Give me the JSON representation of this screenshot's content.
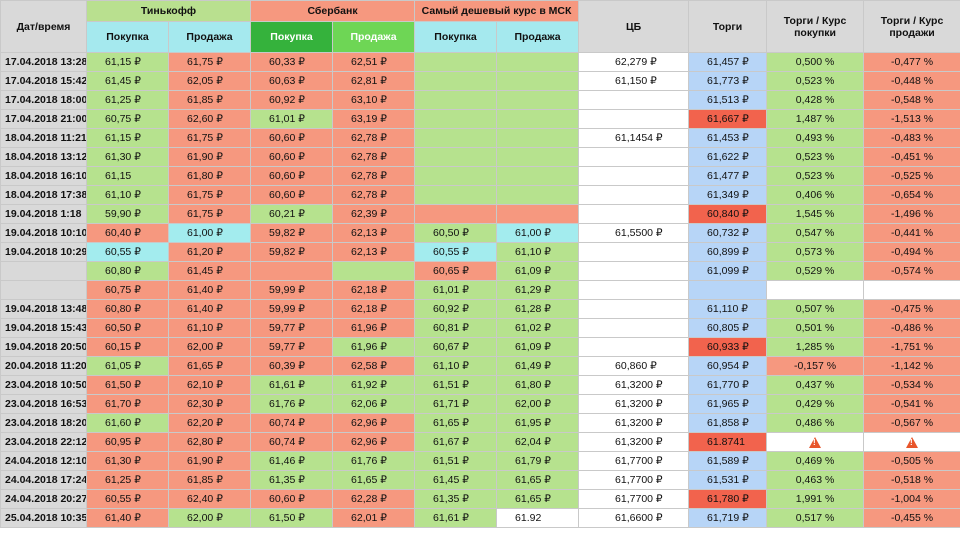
{
  "header": {
    "date_label": "Дат/время",
    "tinkoff": "Тинькофф",
    "sber": "Сбербанк",
    "cheapest": "Самый дешевый курс в МСК",
    "buy": "Покупка",
    "sell": "Продажа",
    "cb": "ЦБ",
    "torgi": "Торги",
    "torgi_buy": "Торги / Курс покупки",
    "torgi_sell": "Торги / Курс продажи"
  },
  "colors": {
    "grey": "#d9d9d9",
    "header_green": "#b9e08f",
    "header_red": "#f6987f",
    "header_blue": "#a5e9ee",
    "header_dark_green": "#35b23c",
    "header_mid_green": "#6ed655",
    "green": "#b6e28e",
    "red": "#f6987f",
    "cyan": "#a3ecee",
    "blue": "#b7d5f7",
    "dark_red": "#f2634d",
    "white": "#ffffff"
  },
  "rows": [
    {
      "date": "17.04.2018 13:28",
      "tb": "61,15 ₽",
      "ts": "61,75 ₽",
      "sb": "60,33 ₽",
      "ss": "62,51 ₽",
      "cb_": "",
      "cs": "",
      "cbr": "62,279 ₽",
      "torgi": "61,457 ₽",
      "pb": "0,500 %",
      "ps": "-0,477 %",
      "colors": [
        "grey",
        "green",
        "red",
        "red",
        "red",
        "green",
        "green",
        "white",
        "blue",
        "green",
        "red"
      ]
    },
    {
      "date": "17.04.2018 15:42",
      "tb": "61,45 ₽",
      "ts": "62,05 ₽",
      "sb": "60,63 ₽",
      "ss": "62,81 ₽",
      "cb_": "",
      "cs": "",
      "cbr": "61,150 ₽",
      "torgi": "61,773 ₽",
      "pb": "0,523 %",
      "ps": "-0,448 %",
      "colors": [
        "grey",
        "green",
        "red",
        "red",
        "red",
        "green",
        "green",
        "white",
        "blue",
        "green",
        "red"
      ]
    },
    {
      "date": "17.04.2018 18:00",
      "tb": "61,25 ₽",
      "ts": "61,85 ₽",
      "sb": "60,92 ₽",
      "ss": "63,10 ₽",
      "cb_": "",
      "cs": "",
      "cbr": "",
      "torgi": "61,513 ₽",
      "pb": "0,428 %",
      "ps": "-0,548 %",
      "colors": [
        "grey",
        "green",
        "red",
        "red",
        "red",
        "green",
        "green",
        "white",
        "blue",
        "green",
        "red"
      ]
    },
    {
      "date": "17.04.2018 21:00",
      "tb": "60,75 ₽",
      "ts": "62,60 ₽",
      "sb": "61,01 ₽",
      "ss": "63,19 ₽",
      "cb_": "",
      "cs": "",
      "cbr": "",
      "torgi": "61,667 ₽",
      "pb": "1,487 %",
      "ps": "-1,513 %",
      "colors": [
        "grey",
        "green",
        "red",
        "green",
        "red",
        "green",
        "green",
        "white",
        "dark_red",
        "green",
        "red"
      ]
    },
    {
      "date": "18.04.2018 11:21",
      "tb": "61,15 ₽",
      "ts": "61,75 ₽",
      "sb": "60,60 ₽",
      "ss": "62,78 ₽",
      "cb_": "",
      "cs": "",
      "cbr": "61,1454 ₽",
      "torgi": "61,453 ₽",
      "pb": "0,493 %",
      "ps": "-0,483 %",
      "colors": [
        "grey",
        "green",
        "red",
        "red",
        "red",
        "green",
        "green",
        "white",
        "blue",
        "green",
        "red"
      ]
    },
    {
      "date": "18.04.2018 13:12",
      "tb": "61,30 ₽",
      "ts": "61,90 ₽",
      "sb": "60,60 ₽",
      "ss": "62,78 ₽",
      "cb_": "",
      "cs": "",
      "cbr": "",
      "torgi": "61,622 ₽",
      "pb": "0,523 %",
      "ps": "-0,451 %",
      "colors": [
        "grey",
        "green",
        "red",
        "red",
        "red",
        "green",
        "green",
        "white",
        "blue",
        "green",
        "red"
      ]
    },
    {
      "date": "18.04.2018 16:10",
      "tb": "61,15",
      "ts": "61,80 ₽",
      "sb": "60,60 ₽",
      "ss": "62,78 ₽",
      "cb_": "",
      "cs": "",
      "cbr": "",
      "torgi": "61,477 ₽",
      "pb": "0,523 %",
      "ps": "-0,525 %",
      "colors": [
        "grey",
        "green",
        "red",
        "red",
        "red",
        "green",
        "green",
        "white",
        "blue",
        "green",
        "red"
      ]
    },
    {
      "date": "18.04.2018 17:38",
      "tb": "61,10 ₽",
      "ts": "61,75 ₽",
      "sb": "60,60 ₽",
      "ss": "62,78 ₽",
      "cb_": "",
      "cs": "",
      "cbr": "",
      "torgi": "61,349 ₽",
      "pb": "0,406 %",
      "ps": "-0,654 %",
      "colors": [
        "grey",
        "green",
        "red",
        "red",
        "red",
        "green",
        "green",
        "white",
        "blue",
        "green",
        "red"
      ]
    },
    {
      "date": "19.04.2018 1:18",
      "tb": "59,90 ₽",
      "ts": "61,75 ₽",
      "sb": "60,21 ₽",
      "ss": "62,39 ₽",
      "cb_": "",
      "cs": "",
      "cbr": "",
      "torgi": "60,840 ₽",
      "pb": "1,545 %",
      "ps": "-1,496 %",
      "colors": [
        "grey",
        "green",
        "red",
        "green",
        "red",
        "red",
        "red",
        "white",
        "dark_red",
        "green",
        "red"
      ]
    },
    {
      "date": "19.04.2018 10:10",
      "tb": "60,40 ₽",
      "ts": "61,00 ₽",
      "sb": "59,82 ₽",
      "ss": "62,13 ₽",
      "cb_": "60,50 ₽",
      "cs": "61,00 ₽",
      "cbr": "61,5500 ₽",
      "torgi": "60,732 ₽",
      "pb": "0,547 %",
      "ps": "-0,441 %",
      "colors": [
        "grey",
        "red",
        "cyan",
        "red",
        "red",
        "green",
        "cyan",
        "white",
        "blue",
        "green",
        "red"
      ]
    },
    {
      "date": "19.04.2018 10:29",
      "tb": "60,55 ₽",
      "ts": "61,20 ₽",
      "sb": "59,82 ₽",
      "ss": "62,13 ₽",
      "cb_": "60,55 ₽",
      "cs": "61,10 ₽",
      "cbr": "",
      "torgi": "60,899 ₽",
      "pb": "0,573 %",
      "ps": "-0,494 %",
      "colors": [
        "grey",
        "cyan",
        "red",
        "red",
        "red",
        "cyan",
        "green",
        "white",
        "blue",
        "green",
        "red"
      ]
    },
    {
      "date": "",
      "tb": "60,80 ₽",
      "ts": "61,45 ₽",
      "sb": "",
      "ss": "",
      "cb_": "60,65 ₽",
      "cs": "61,09 ₽",
      "cbr": "",
      "torgi": "61,099 ₽",
      "pb": "0,529 %",
      "ps": "-0,574 %",
      "colors": [
        "grey",
        "green",
        "red",
        "red",
        "green",
        "red",
        "green",
        "white",
        "blue",
        "green",
        "red"
      ]
    },
    {
      "date": "",
      "tb": "60,75 ₽",
      "ts": "61,40 ₽",
      "sb": "59,99 ₽",
      "ss": "62,18 ₽",
      "cb_": "61,01 ₽",
      "cs": "61,29 ₽",
      "cbr": "",
      "torgi": "",
      "pb": "",
      "ps": "",
      "colors": [
        "grey",
        "red",
        "red",
        "red",
        "red",
        "green",
        "green",
        "white",
        "blue",
        "white",
        "white"
      ]
    },
    {
      "date": "19.04.2018 13:48",
      "tb": "60,80 ₽",
      "ts": "61,40 ₽",
      "sb": "59,99 ₽",
      "ss": "62,18 ₽",
      "cb_": "60,92 ₽",
      "cs": "61,28 ₽",
      "cbr": "",
      "torgi": "61,110 ₽",
      "pb": "0,507 %",
      "ps": "-0,475 %",
      "colors": [
        "grey",
        "red",
        "red",
        "red",
        "red",
        "green",
        "green",
        "white",
        "blue",
        "green",
        "red"
      ]
    },
    {
      "date": "19.04.2018 15:43",
      "tb": "60,50 ₽",
      "ts": "61,10 ₽",
      "sb": "59,77 ₽",
      "ss": "61,96 ₽",
      "cb_": "60,81 ₽",
      "cs": "61,02 ₽",
      "cbr": "",
      "torgi": "60,805 ₽",
      "pb": "0,501 %",
      "ps": "-0,486 %",
      "colors": [
        "grey",
        "red",
        "red",
        "red",
        "red",
        "green",
        "green",
        "white",
        "blue",
        "green",
        "red"
      ]
    },
    {
      "date": "19.04.2018 20:50",
      "tb": "60,15 ₽",
      "ts": "62,00 ₽",
      "sb": "59,77 ₽",
      "ss": "61,96 ₽",
      "cb_": "60,67 ₽",
      "cs": "61,09 ₽",
      "cbr": "",
      "torgi": "60,933 ₽",
      "pb": "1,285 %",
      "ps": "-1,751 %",
      "colors": [
        "grey",
        "red",
        "red",
        "red",
        "green",
        "green",
        "green",
        "white",
        "dark_red",
        "green",
        "red"
      ]
    },
    {
      "date": "20.04.2018 11:20",
      "tb": "61,05 ₽",
      "ts": "61,65 ₽",
      "sb": "60,39 ₽",
      "ss": "62,58 ₽",
      "cb_": "61,10 ₽",
      "cs": "61,49 ₽",
      "cbr": "60,860 ₽",
      "torgi": "60,954 ₽",
      "pb": "-0,157 %",
      "ps": "-1,142 %",
      "colors": [
        "grey",
        "green",
        "red",
        "red",
        "red",
        "green",
        "green",
        "white",
        "blue",
        "red",
        "red"
      ]
    },
    {
      "date": "23.04.2018 10:50",
      "tb": "61,50 ₽",
      "ts": "62,10 ₽",
      "sb": "61,61 ₽",
      "ss": "61,92 ₽",
      "cb_": "61,51 ₽",
      "cs": "61,80 ₽",
      "cbr": "61,3200 ₽",
      "torgi": "61,770 ₽",
      "pb": "0,437 %",
      "ps": "-0,534 %",
      "colors": [
        "grey",
        "red",
        "red",
        "green",
        "green",
        "green",
        "green",
        "white",
        "blue",
        "green",
        "red"
      ]
    },
    {
      "date": "23.04.2018 16:53",
      "tb": "61,70 ₽",
      "ts": "62,30 ₽",
      "sb": "61,76 ₽",
      "ss": "62,06 ₽",
      "cb_": "61,71 ₽",
      "cs": "62,00 ₽",
      "cbr": "61,3200 ₽",
      "torgi": "61,965 ₽",
      "pb": "0,429 %",
      "ps": "-0,541 %",
      "colors": [
        "grey",
        "red",
        "red",
        "green",
        "green",
        "green",
        "green",
        "white",
        "blue",
        "green",
        "red"
      ]
    },
    {
      "date": "23.04.2018 18:20",
      "tb": "61,60 ₽",
      "ts": "62,20 ₽",
      "sb": "60,74 ₽",
      "ss": "62,96 ₽",
      "cb_": "61,65 ₽",
      "cs": "61,95 ₽",
      "cbr": "61,3200 ₽",
      "torgi": "61,858 ₽",
      "pb": "0,486 %",
      "ps": "-0,567 %",
      "colors": [
        "grey",
        "green",
        "red",
        "red",
        "red",
        "green",
        "green",
        "white",
        "blue",
        "green",
        "red"
      ]
    },
    {
      "date": "23.04.2018 22:12",
      "tb": "60,95 ₽",
      "ts": "62,80 ₽",
      "sb": "60,74 ₽",
      "ss": "62,96 ₽",
      "cb_": "61,67 ₽",
      "cs": "62,04 ₽",
      "cbr": "61,3200 ₽",
      "torgi": "61.8741",
      "pb": "",
      "ps": "",
      "warn": true,
      "colors": [
        "grey",
        "red",
        "red",
        "red",
        "red",
        "green",
        "green",
        "white",
        "dark_red",
        "white",
        "white"
      ]
    },
    {
      "date": "24.04.2018 12:10",
      "tb": "61,30 ₽",
      "ts": "61,90 ₽",
      "sb": "61,46 ₽",
      "ss": "61,76 ₽",
      "cb_": "61,51 ₽",
      "cs": "61,79 ₽",
      "cbr": "61,7700 ₽",
      "torgi": "61,589 ₽",
      "pb": "0,469 %",
      "ps": "-0,505 %",
      "colors": [
        "grey",
        "red",
        "red",
        "green",
        "green",
        "green",
        "green",
        "white",
        "blue",
        "green",
        "red"
      ]
    },
    {
      "date": "24.04.2018 17:24",
      "tb": "61,25 ₽",
      "ts": "61,85 ₽",
      "sb": "61,35 ₽",
      "ss": "61,65 ₽",
      "cb_": "61,45 ₽",
      "cs": "61,65 ₽",
      "cbr": "61,7700 ₽",
      "torgi": "61,531 ₽",
      "pb": "0,463 %",
      "ps": "-0,518 %",
      "colors": [
        "grey",
        "red",
        "red",
        "green",
        "green",
        "green",
        "green",
        "white",
        "blue",
        "green",
        "red"
      ]
    },
    {
      "date": "24.04.2018 20:27",
      "tb": "60,55 ₽",
      "ts": "62,40 ₽",
      "sb": "60,60 ₽",
      "ss": "62,28 ₽",
      "cb_": "61,35 ₽",
      "cs": "61,65 ₽",
      "cbr": "61,7700 ₽",
      "torgi": "61,780 ₽",
      "pb": "1,991 %",
      "ps": "-1,004 %",
      "colors": [
        "grey",
        "red",
        "red",
        "red",
        "red",
        "green",
        "green",
        "white",
        "dark_red",
        "green",
        "red"
      ]
    },
    {
      "date": "25.04.2018 10:35",
      "tb": "61,40 ₽",
      "ts": "62,00 ₽",
      "sb": "61,50 ₽",
      "ss": "62,01 ₽",
      "cb_": "61,61 ₽",
      "cs": "61.92",
      "cbr": "61,6600 ₽",
      "torgi": "61,719 ₽",
      "pb": "0,517 %",
      "ps": "-0,455 %",
      "colors": [
        "grey",
        "red",
        "green",
        "green",
        "red",
        "green",
        "white",
        "white",
        "blue",
        "green",
        "red"
      ]
    }
  ]
}
